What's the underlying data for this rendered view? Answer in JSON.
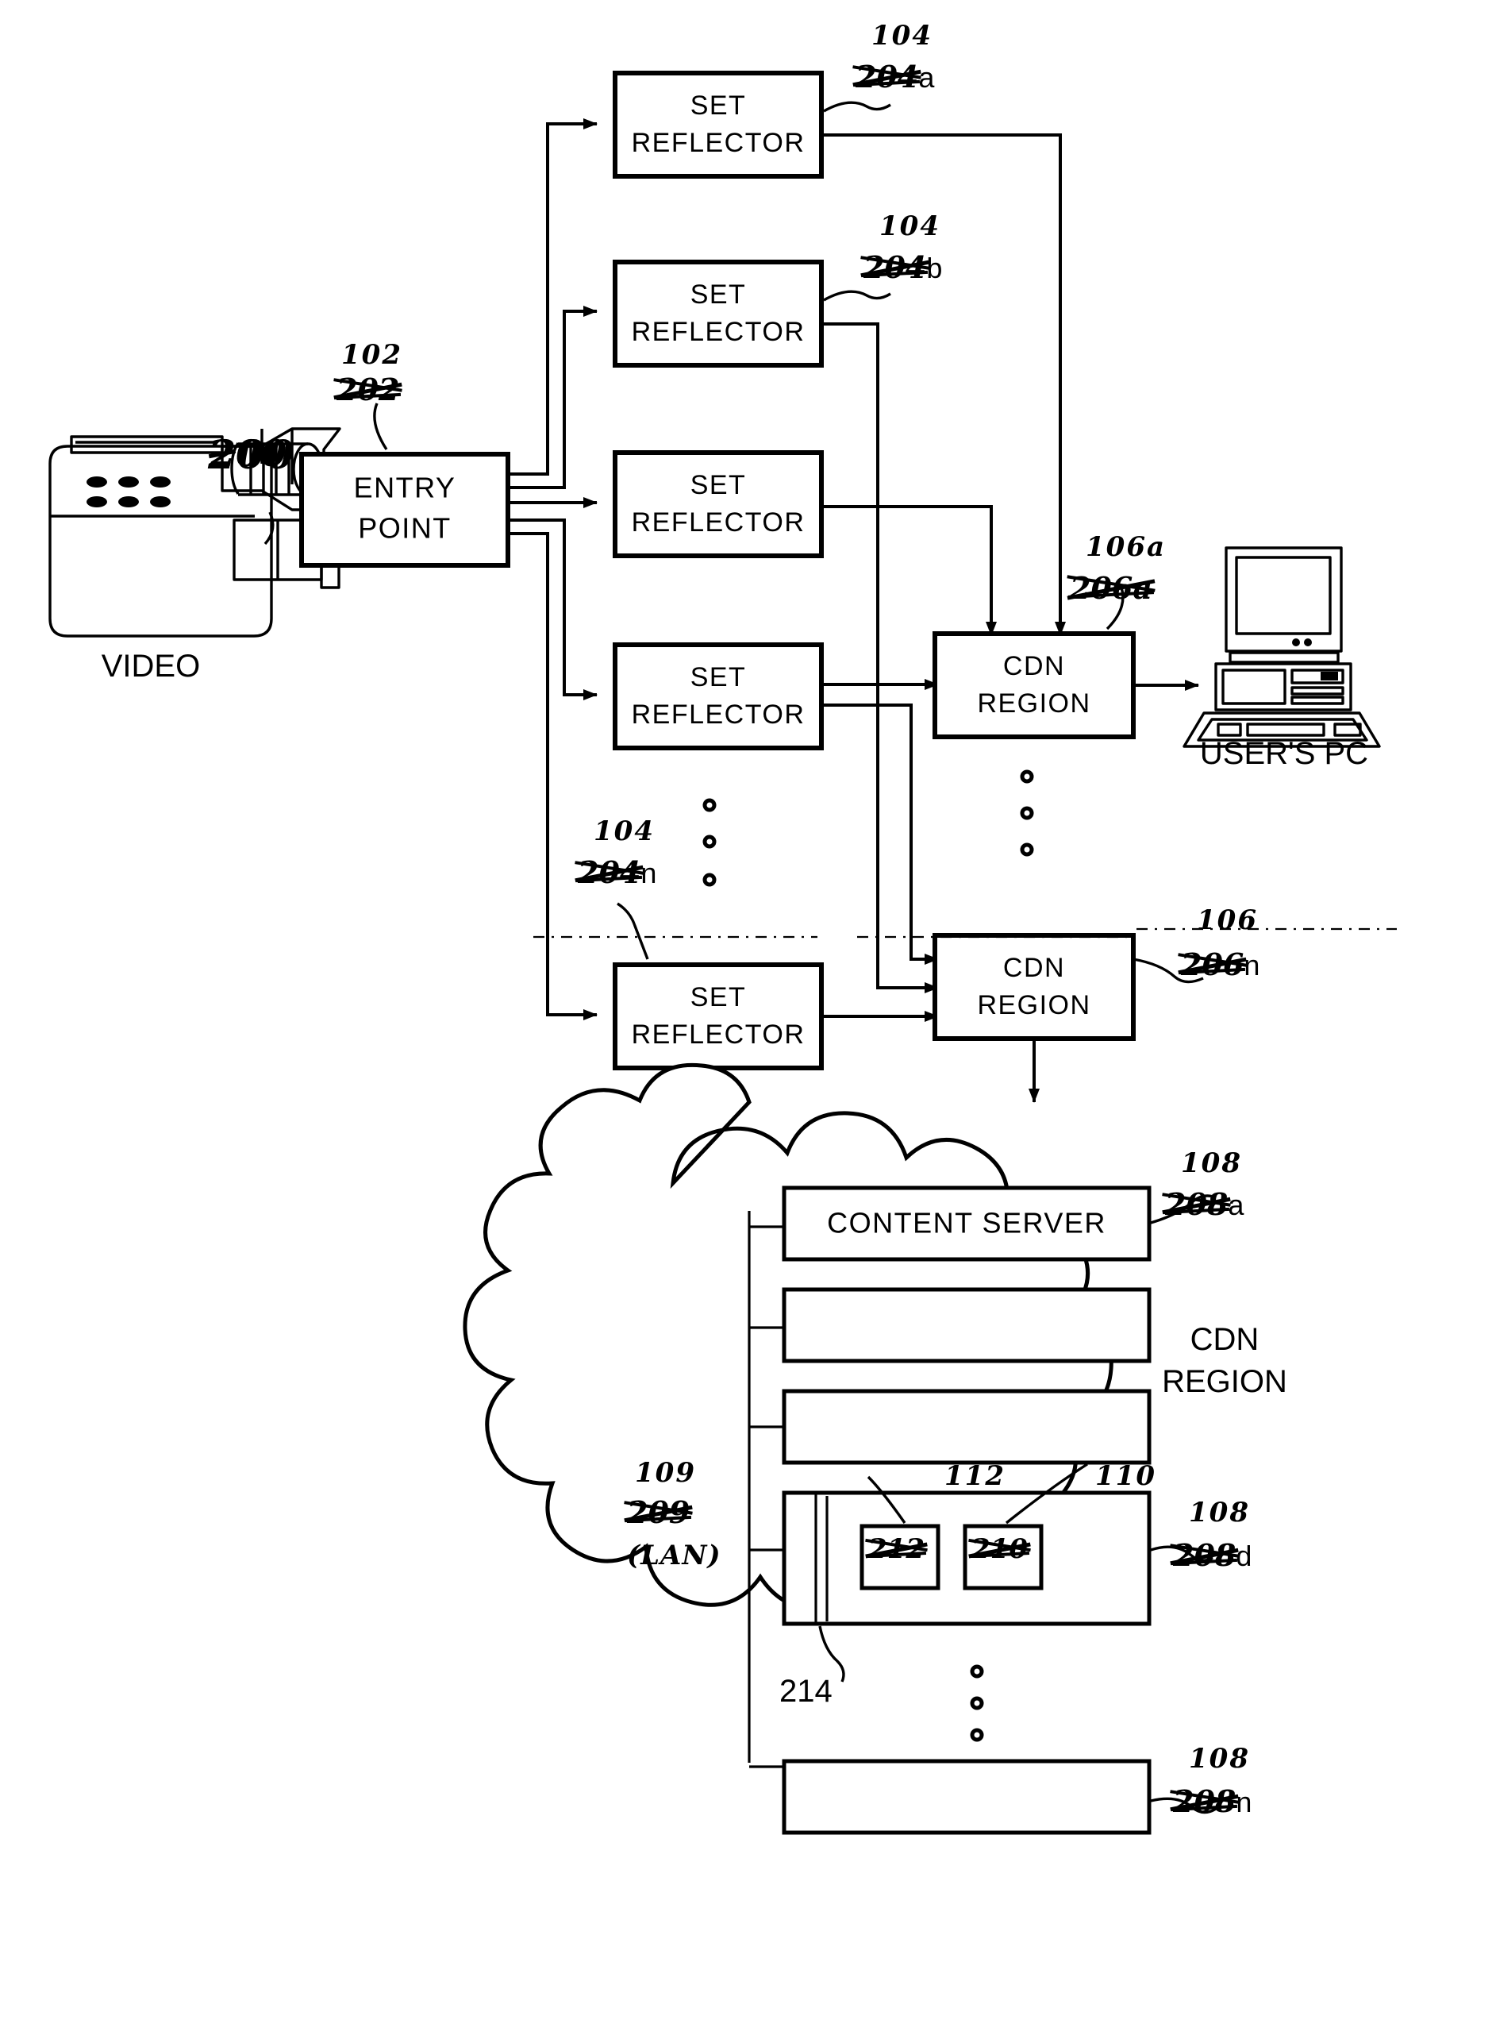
{
  "figure": {
    "type": "patent-block-diagram",
    "title_text": "",
    "nodes": {
      "video_source_label": "VIDEO",
      "entry_point_label": [
        "ENTRY",
        "POINT"
      ],
      "set_reflector_label": [
        "SET",
        "REFLECTOR"
      ],
      "cdn_region_label": [
        "CDN",
        "REGION"
      ],
      "users_pc_label": "USER'S  PC",
      "content_server_label": "CONTENT  SERVER",
      "cloud_caption": [
        "CDN",
        "REGION"
      ]
    },
    "set_reflectors": [
      {
        "id": "sr-a",
        "line1": "SET",
        "line2": "REFLECTOR"
      },
      {
        "id": "sr-b",
        "line1": "SET",
        "line2": "REFLECTOR"
      },
      {
        "id": "sr-c",
        "line1": "SET",
        "line2": "REFLECTOR"
      },
      {
        "id": "sr-d",
        "line1": "SET",
        "line2": "REFLECTOR"
      },
      {
        "id": "sr-n",
        "line1": "SET",
        "line2": "REFLECTOR"
      }
    ],
    "cdn_regions": [
      {
        "id": "cdn-a",
        "line1": "CDN",
        "line2": "REGION"
      },
      {
        "id": "cdn-n",
        "line1": "CDN",
        "line2": "REGION"
      }
    ],
    "annotations": [
      {
        "id": "ann-200",
        "new": "1",
        "old": "200",
        "suffix": "",
        "style": "overwrite"
      },
      {
        "id": "ann-102",
        "new": "102",
        "old": "202",
        "suffix": ""
      },
      {
        "id": "ann-104a",
        "new": "104",
        "old": "204",
        "suffix": "a"
      },
      {
        "id": "ann-104b",
        "new": "104",
        "old": "204",
        "suffix": "b"
      },
      {
        "id": "ann-104n",
        "new": "104",
        "old": "204",
        "suffix": "n"
      },
      {
        "id": "ann-106a",
        "new": "106a",
        "old": "206a",
        "suffix": ""
      },
      {
        "id": "ann-106n",
        "new": "106",
        "old": "206",
        "suffix": "n"
      },
      {
        "id": "ann-108a",
        "new": "108",
        "old": "208",
        "suffix": "a"
      },
      {
        "id": "ann-109",
        "new": "109",
        "old": "209",
        "suffix": "",
        "extra": "(LAN)"
      },
      {
        "id": "ann-112",
        "new": "112",
        "old": "",
        "suffix": ""
      },
      {
        "id": "ann-110",
        "new": "110",
        "old": "",
        "suffix": ""
      },
      {
        "id": "ann-112box",
        "new": "",
        "old": "212",
        "suffix": ""
      },
      {
        "id": "ann-110box",
        "new": "",
        "old": "210",
        "suffix": ""
      },
      {
        "id": "ann-108d",
        "new": "108",
        "old": "208",
        "suffix": "d"
      },
      {
        "id": "ann-108n",
        "new": "108",
        "old": "208",
        "suffix": "n"
      },
      {
        "id": "ann-214",
        "new": "214",
        "old": "",
        "suffix": "",
        "style": "printed"
      }
    ],
    "ellipsis_groups": [
      {
        "id": "ellipsis-reflectors",
        "count": 3
      },
      {
        "id": "ellipsis-cdn",
        "count": 3
      },
      {
        "id": "ellipsis-servers",
        "count": 3
      }
    ],
    "colors": {
      "ink": "#000000",
      "paper": "#ffffff"
    }
  }
}
